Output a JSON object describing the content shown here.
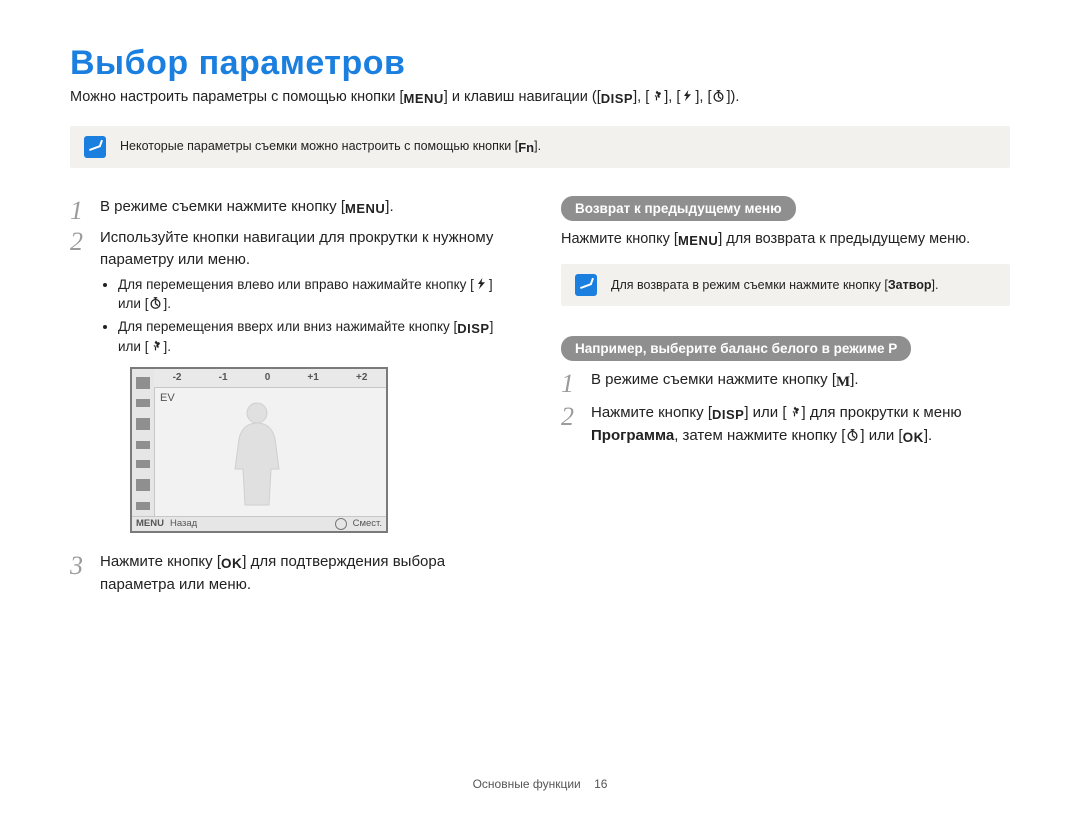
{
  "title": "Выбор параметров",
  "intro": {
    "prefix": "Можно настроить параметры с помощью кнопки [",
    "after_menu": "] и клавиш навигации ([",
    "suffix": "])."
  },
  "keys": {
    "menu": "MENU",
    "disp": "DISP",
    "fn": "Fn",
    "ok": "OK",
    "m": "M",
    "shutter": "Затвор"
  },
  "note_top": {
    "pre": "Некоторые параметры съемки можно настроить с помощью кнопки [",
    "post": "]."
  },
  "left": {
    "step1": {
      "pre": "В режиме съемки нажмите кнопку [",
      "post": "]."
    },
    "step2": "Используйте кнопки навигации для прокрутки к нужному параметру или меню.",
    "sub1": {
      "pre": "Для перемещения влево или вправо нажимайте кнопку [",
      "mid": "] или [",
      "post": "]."
    },
    "sub2": {
      "pre": "Для перемещения вверх или вниз нажимайте кнопку [",
      "mid": "] или [",
      "post": "]."
    },
    "step3": {
      "pre": "Нажмите кнопку [",
      "post": "] для подтверждения выбора параметра или меню."
    }
  },
  "lcd": {
    "ticks": [
      "-2",
      "-1",
      "0",
      "+1",
      "+2"
    ],
    "ev": "EV",
    "menu": "MENU",
    "back": "Назад",
    "move": "Смест."
  },
  "right": {
    "pill1": "Возврат к предыдущему меню",
    "ret": {
      "pre": "Нажмите кнопку [",
      "post": "] для возврата к предыдущему меню."
    },
    "note": {
      "pre": "Для возврата в режим съемки нажмите кнопку [",
      "post": "]."
    },
    "pill2": "Например, выберите баланс белого в режиме P",
    "step1": {
      "pre": "В режиме съемки нажмите кнопку [",
      "post": "]."
    },
    "step2": {
      "pre": "Нажмите кнопку [",
      "mid1": "] или [",
      "mid2": "] для прокрутки к меню ",
      "program": "Программа",
      "mid3": ", затем нажмите кнопку [",
      "mid4": "] или [",
      "post": "]."
    }
  },
  "footer": {
    "section": "Основные функции",
    "page": "16"
  }
}
